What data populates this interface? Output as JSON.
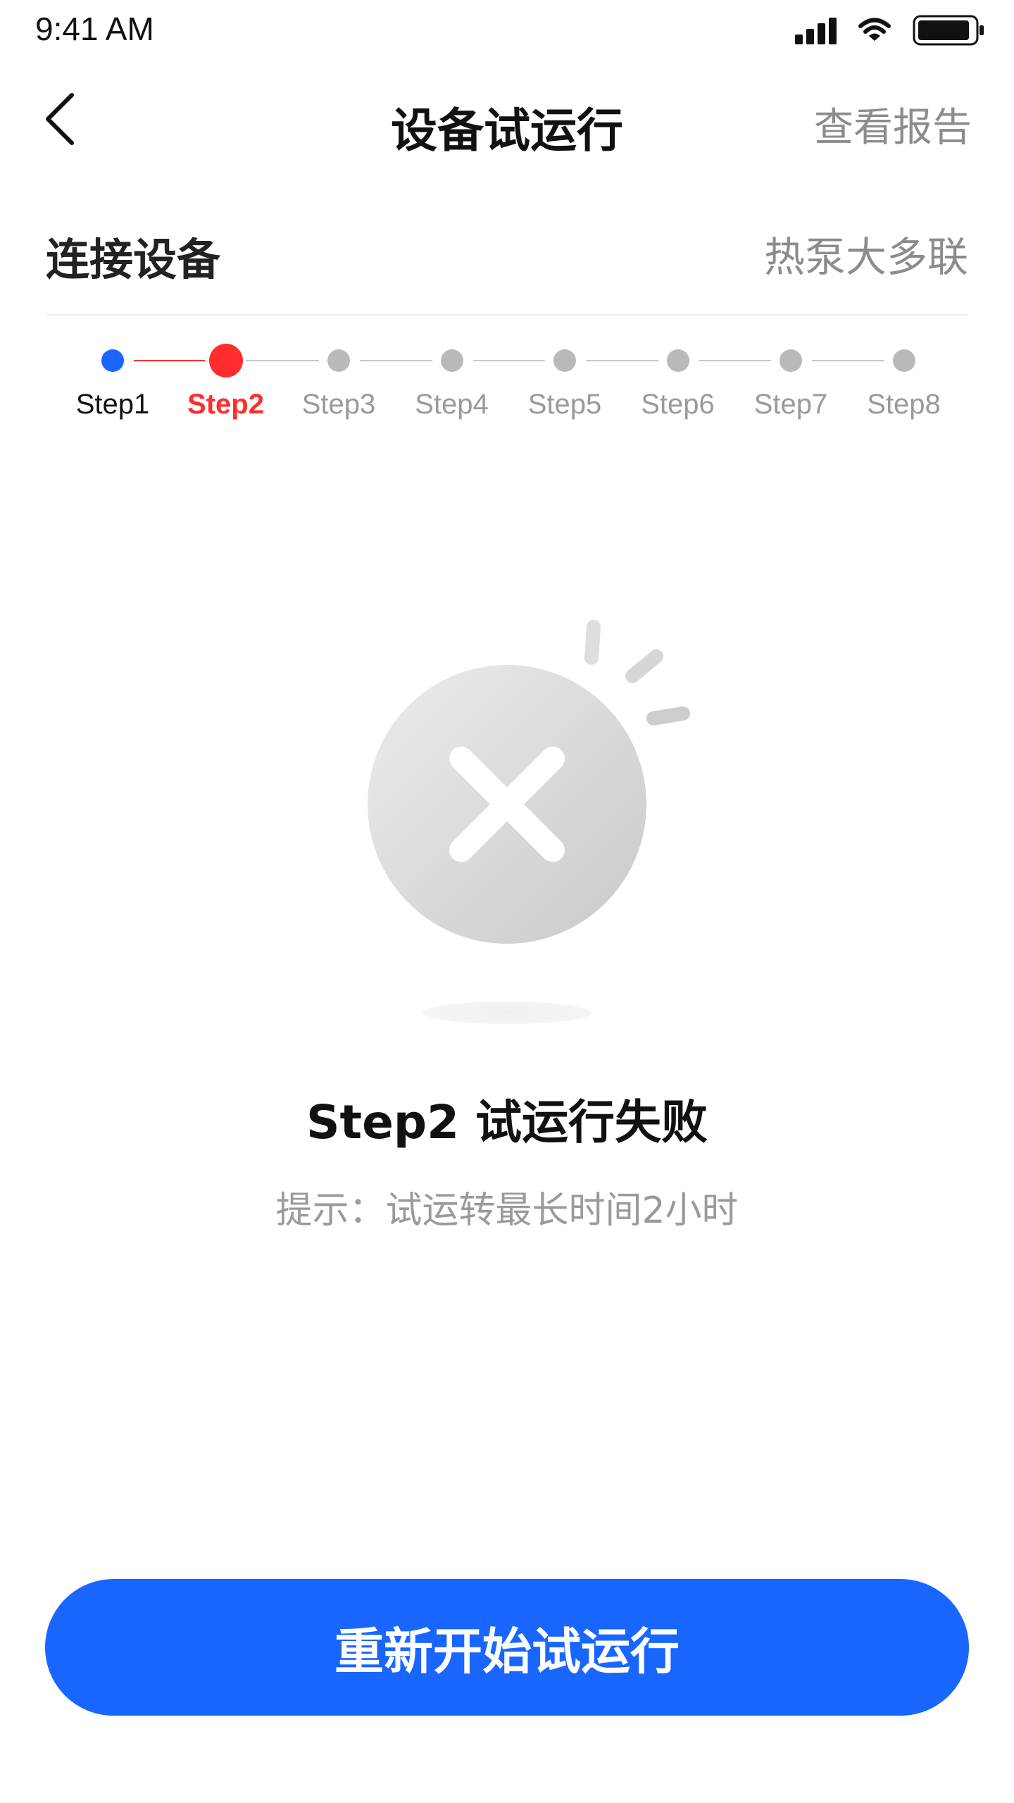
{
  "status_bar": {
    "time": "9:41 AM"
  },
  "nav": {
    "title": "设备试运行",
    "report_link": "查看报告"
  },
  "section": {
    "title": "连接设备",
    "device_type": "热泵大多联"
  },
  "stepper": {
    "current_step": 2,
    "steps": [
      "Step1",
      "Step2",
      "Step3",
      "Step4",
      "Step5",
      "Step6",
      "Step7",
      "Step8"
    ]
  },
  "result": {
    "status_text": "Step2 试运行失败",
    "hint": "提示：试运转最长时间2小时"
  },
  "action": {
    "restart_label": "重新开始试运行"
  },
  "colors": {
    "primary_blue": "#1966ff",
    "error_red": "#ff2d2d",
    "completed_dot": "#1966ff",
    "pending_gray": "#b9b9b9"
  },
  "icons": {
    "back": "chevron-left-icon",
    "failure": "close-circle-icon",
    "signal": "signal-icon",
    "wifi": "wifi-icon",
    "battery": "battery-icon"
  }
}
